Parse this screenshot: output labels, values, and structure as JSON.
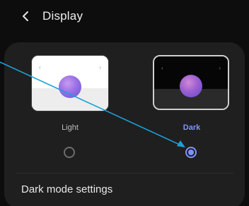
{
  "header": {
    "title": "Display",
    "back_icon": "chevron-left-icon"
  },
  "theme_options": {
    "light": {
      "label": "Light",
      "selected": false
    },
    "dark": {
      "label": "Dark",
      "selected": true
    }
  },
  "settings": {
    "dark_mode_settings_label": "Dark mode settings"
  },
  "colors": {
    "accent": "#7f93ff",
    "annotation_arrow": "#1aa0d8",
    "card_background": "#1f1f1f",
    "page_background": "#0d0d0d"
  }
}
